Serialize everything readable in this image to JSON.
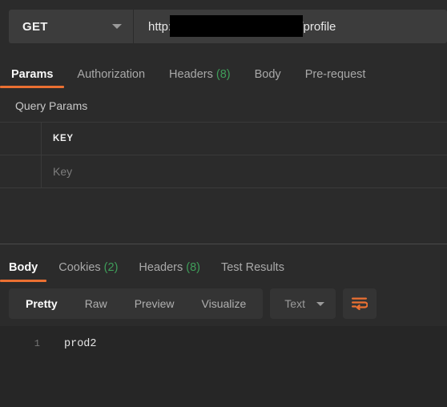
{
  "request": {
    "method": "GET",
    "method_caret_icon": "chevron-down-icon",
    "url_prefix": "http:/",
    "url_redacted": "",
    "url_suffix": "/profile",
    "tabs": [
      {
        "label": "Params",
        "count": "",
        "active": true
      },
      {
        "label": "Authorization",
        "count": "",
        "active": false
      },
      {
        "label": "Headers",
        "count": "(8)",
        "active": false
      },
      {
        "label": "Body",
        "count": "",
        "active": false
      },
      {
        "label": "Pre-request",
        "count": "",
        "active": false
      }
    ],
    "query_params": {
      "section_title": "Query Params",
      "columns": [
        "KEY"
      ],
      "rows": [
        {
          "key_placeholder": "Key"
        }
      ]
    }
  },
  "response": {
    "tabs": [
      {
        "label": "Body",
        "count": "",
        "active": true
      },
      {
        "label": "Cookies",
        "count": "(2)",
        "active": false
      },
      {
        "label": "Headers",
        "count": "(8)",
        "active": false
      },
      {
        "label": "Test Results",
        "count": "",
        "active": false
      }
    ],
    "format_modes": [
      {
        "label": "Pretty",
        "active": true
      },
      {
        "label": "Raw",
        "active": false
      },
      {
        "label": "Preview",
        "active": false
      },
      {
        "label": "Visualize",
        "active": false
      }
    ],
    "language": "Text",
    "language_caret_icon": "chevron-down-icon",
    "wrap_button_icon": "word-wrap-icon",
    "body": {
      "lines": [
        {
          "number": "1",
          "text": "prod2"
        }
      ]
    }
  },
  "colors": {
    "accent": "#eb7032",
    "count_green": "#3f9e5a",
    "panel_bg": "#2b2b2b",
    "field_bg": "#3c3c3c",
    "viewer_bg": "#262626"
  }
}
